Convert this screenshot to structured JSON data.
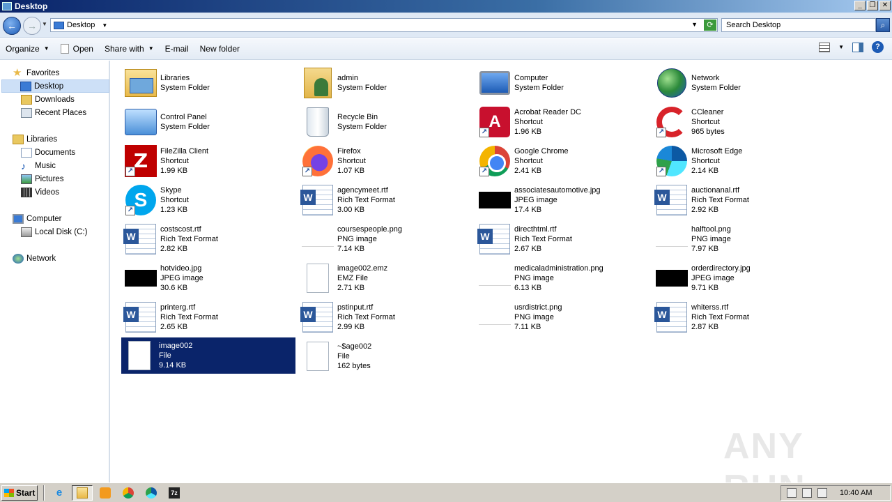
{
  "window": {
    "title": "Desktop",
    "controls": [
      "minimize-icon",
      "restore-icon",
      "close-icon"
    ]
  },
  "address": {
    "location": "Desktop",
    "search_placeholder": "Search Desktop"
  },
  "toolbar": {
    "organize": "Organize",
    "open": "Open",
    "share_with": "Share with",
    "email": "E-mail",
    "new_folder": "New folder"
  },
  "nav": {
    "favorites": "Favorites",
    "desktop": "Desktop",
    "downloads": "Downloads",
    "recent_places": "Recent Places",
    "libraries": "Libraries",
    "documents": "Documents",
    "music": "Music",
    "pictures": "Pictures",
    "videos": "Videos",
    "computer": "Computer",
    "local_disk": "Local Disk (C:)",
    "network": "Network"
  },
  "items": [
    {
      "name": "Libraries",
      "type": "System Folder",
      "size": "",
      "icon": "libraries-icon"
    },
    {
      "name": "admin",
      "type": "System Folder",
      "size": "",
      "icon": "user-folder-icon"
    },
    {
      "name": "Computer",
      "type": "System Folder",
      "size": "",
      "icon": "computer-icon"
    },
    {
      "name": "Network",
      "type": "System Folder",
      "size": "",
      "icon": "network-icon"
    },
    {
      "name": "Control Panel",
      "type": "System Folder",
      "size": "",
      "icon": "control-panel-icon"
    },
    {
      "name": "Recycle Bin",
      "type": "System Folder",
      "size": "",
      "icon": "recycle-bin-icon"
    },
    {
      "name": "Acrobat Reader DC",
      "type": "Shortcut",
      "size": "1.96 KB",
      "icon": "acrobat-icon"
    },
    {
      "name": "CCleaner",
      "type": "Shortcut",
      "size": "965 bytes",
      "icon": "ccleaner-icon"
    },
    {
      "name": "FileZilla Client",
      "type": "Shortcut",
      "size": "1.99 KB",
      "icon": "filezilla-icon"
    },
    {
      "name": "Firefox",
      "type": "Shortcut",
      "size": "1.07 KB",
      "icon": "firefox-icon"
    },
    {
      "name": "Google Chrome",
      "type": "Shortcut",
      "size": "2.41 KB",
      "icon": "chrome-icon"
    },
    {
      "name": "Microsoft Edge",
      "type": "Shortcut",
      "size": "2.14 KB",
      "icon": "edge-icon"
    },
    {
      "name": "Skype",
      "type": "Shortcut",
      "size": "1.23 KB",
      "icon": "skype-icon"
    },
    {
      "name": "agencymeet.rtf",
      "type": "Rich Text Format",
      "size": "3.00 KB",
      "icon": "rtf-icon"
    },
    {
      "name": "associatesautomotive.jpg",
      "type": "JPEG image",
      "size": "17.4 KB",
      "icon": "jpeg-thumb-icon"
    },
    {
      "name": "auctionanal.rtf",
      "type": "Rich Text Format",
      "size": "2.92 KB",
      "icon": "rtf-icon"
    },
    {
      "name": "costscost.rtf",
      "type": "Rich Text Format",
      "size": "2.82 KB",
      "icon": "rtf-icon"
    },
    {
      "name": "coursespeople.png",
      "type": "PNG image",
      "size": "7.14 KB",
      "icon": "png-thumb-icon"
    },
    {
      "name": "directhtml.rtf",
      "type": "Rich Text Format",
      "size": "2.67 KB",
      "icon": "rtf-icon"
    },
    {
      "name": "halftool.png",
      "type": "PNG image",
      "size": "7.97 KB",
      "icon": "png-thumb-icon"
    },
    {
      "name": "hotvideo.jpg",
      "type": "JPEG image",
      "size": "30.6 KB",
      "icon": "jpeg-thumb-icon"
    },
    {
      "name": "image002.emz",
      "type": "EMZ File",
      "size": "2.71 KB",
      "icon": "file-icon"
    },
    {
      "name": "medicaladministration.png",
      "type": "PNG image",
      "size": "6.13 KB",
      "icon": "png-thumb-icon"
    },
    {
      "name": "orderdirectory.jpg",
      "type": "JPEG image",
      "size": "9.71 KB",
      "icon": "jpeg-thumb-icon"
    },
    {
      "name": "printerg.rtf",
      "type": "Rich Text Format",
      "size": "2.65 KB",
      "icon": "rtf-icon"
    },
    {
      "name": "pstinput.rtf",
      "type": "Rich Text Format",
      "size": "2.99 KB",
      "icon": "rtf-icon"
    },
    {
      "name": "usrdistrict.png",
      "type": "PNG image",
      "size": "7.11 KB",
      "icon": "png-thumb-icon"
    },
    {
      "name": "whiterss.rtf",
      "type": "Rich Text Format",
      "size": "2.87 KB",
      "icon": "rtf-icon"
    },
    {
      "name": "image002",
      "type": "File",
      "size": "9.14 KB",
      "icon": "file-icon",
      "selected": true
    },
    {
      "name": "~$age002",
      "type": "File",
      "size": "162 bytes",
      "icon": "file-icon"
    }
  ],
  "watermark": "ANY RUN",
  "taskbar": {
    "start": "Start",
    "clock": "10:40 AM"
  },
  "colors": {
    "selection": "#0a246a",
    "titlebar": "#0a246a"
  }
}
